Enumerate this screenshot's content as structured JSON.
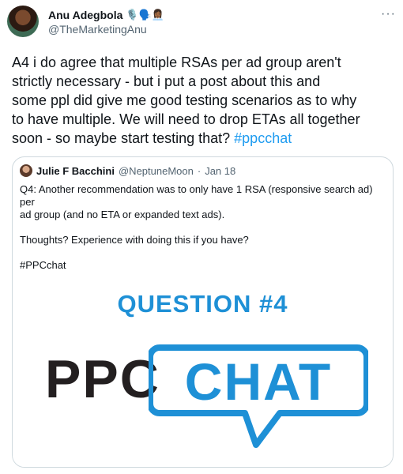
{
  "tweet": {
    "author_name": "Anu Adegbola",
    "name_emojis": "🎙️🗣️👩🏾‍💼",
    "handle": "@TheMarketingAnu",
    "more_label": "···",
    "lines": [
      "A4 i do agree that multiple RSAs per ad group aren't",
      "strictly necessary - but i put a post about this and",
      "some ppl did give me good testing scenarios as to why",
      "to have multiple. We will need to drop ETAs all together"
    ],
    "last_line_text": "soon - so maybe start testing that? ",
    "hashtag": "#ppcchat",
    "hashtag_color": "#1d9bf0"
  },
  "quote": {
    "author_name": "Julie F Bacchini",
    "handle": "@NeptuneMoon",
    "separator": "·",
    "date": "Jan 18",
    "text": "Q4: Another recommendation was to only have 1 RSA (responsive search ad) per\nad group (and no ETA or expanded text ads).\n\nThoughts? Experience with doing this if you have?\n\n#PPCchat",
    "image": {
      "title": "QUESTION #4",
      "logo_left": "PPC",
      "logo_right": "CHAT",
      "title_color": "#1e90d6",
      "ppc_color": "#231f20",
      "chat_color": "#1e90d6"
    }
  }
}
